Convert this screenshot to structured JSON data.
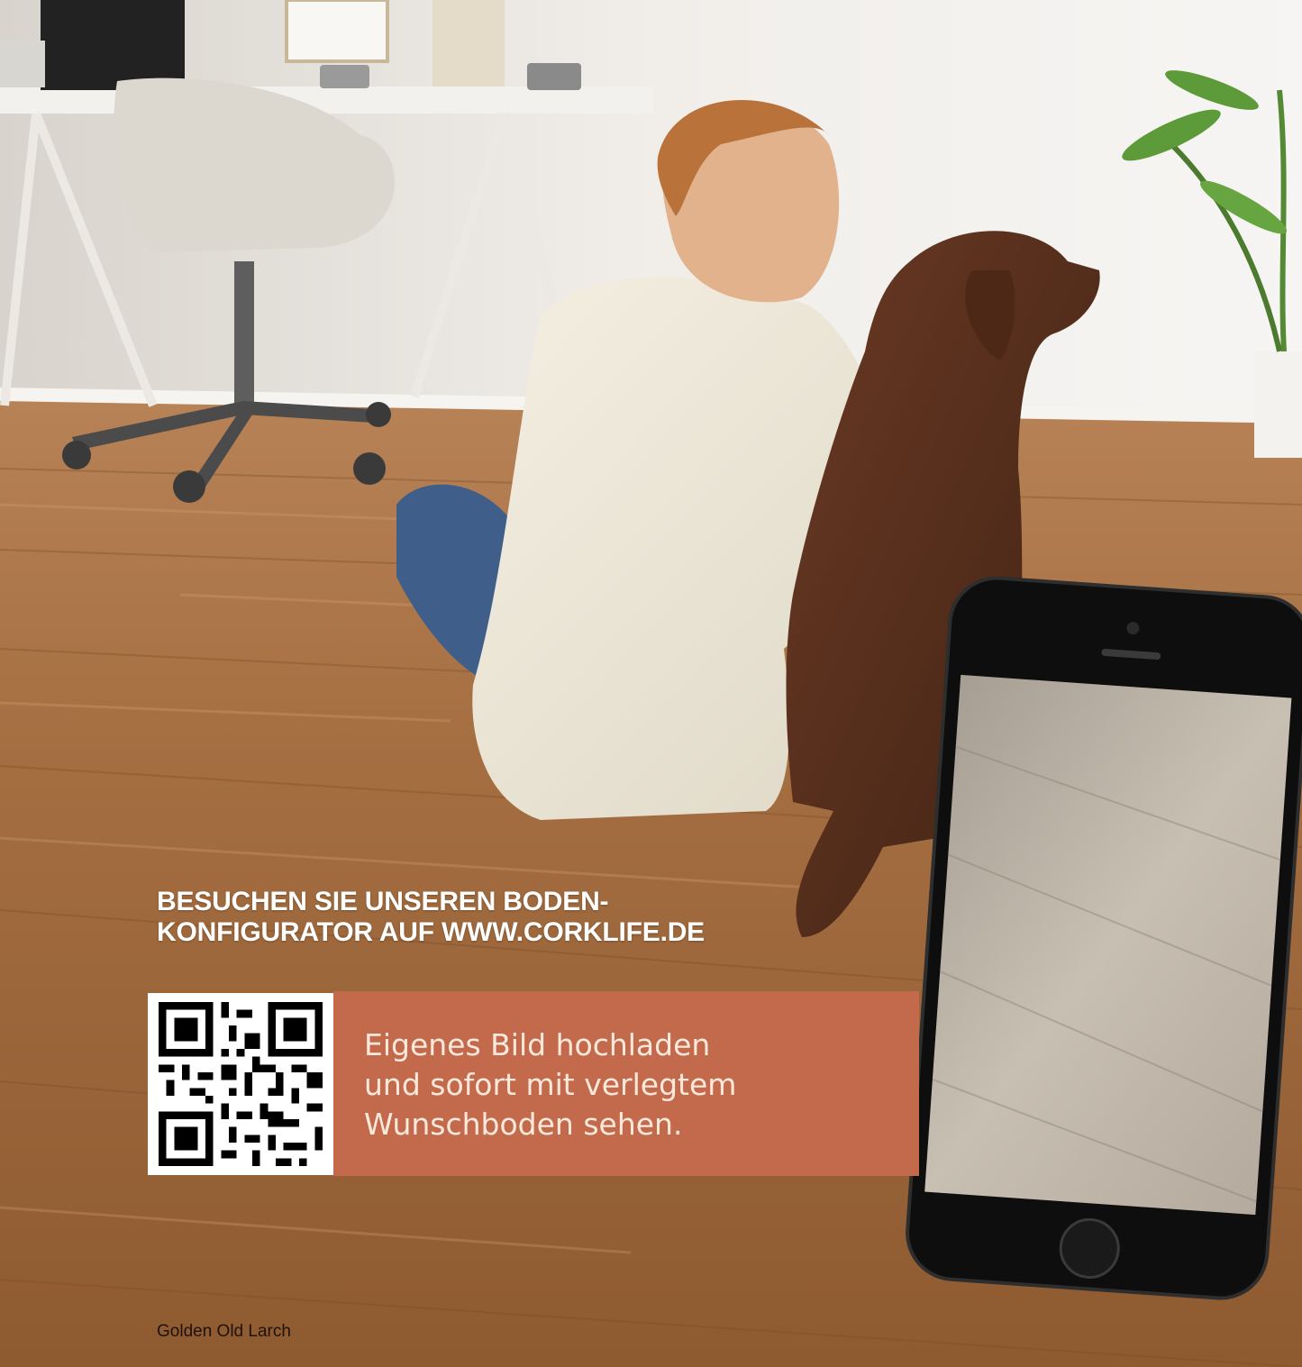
{
  "headline": {
    "line1": "BESUCHEN SIE UNSEREN BODEN-",
    "line2": "KONFIGURATOR AUF WWW.CORKLIFE.DE"
  },
  "promo": {
    "line1": "Eigenes Bild hochladen",
    "line2": "und sofort mit verlegtem",
    "line3": "Wunschboden sehen."
  },
  "caption": "Golden Old Larch",
  "colors": {
    "promo_band": "#c46a4c",
    "headline_text": "#ffffff",
    "wood_floor": "#a06a3c",
    "wall": "#eeeae4"
  }
}
